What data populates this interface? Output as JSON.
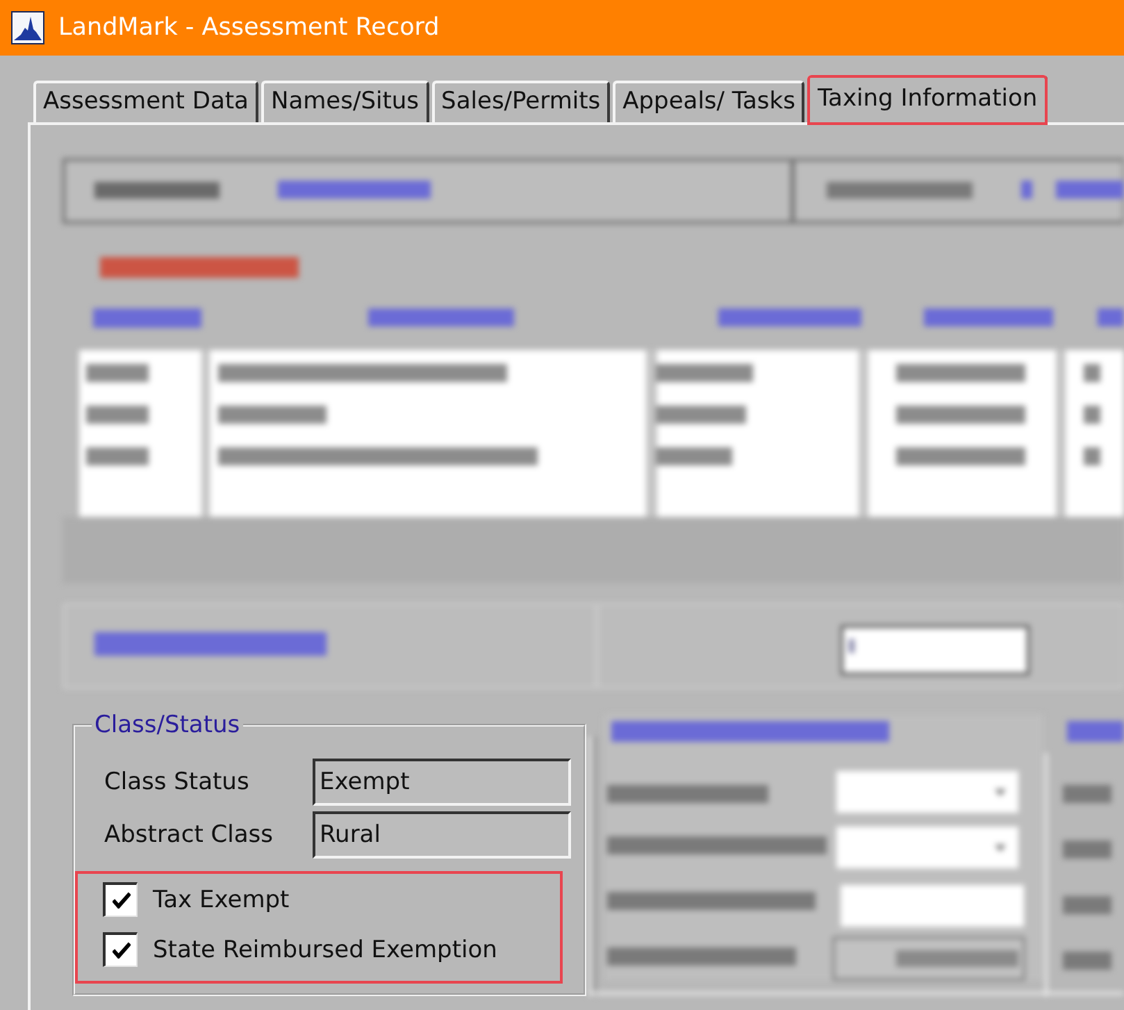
{
  "window": {
    "title": "LandMark - Assessment Record"
  },
  "tabs": [
    {
      "label": "Assessment Data",
      "selected": false,
      "highlighted": false
    },
    {
      "label": "Names/Situs",
      "selected": false,
      "highlighted": false
    },
    {
      "label": "Sales/Permits",
      "selected": false,
      "highlighted": false
    },
    {
      "label": "Appeals/ Tasks",
      "selected": false,
      "highlighted": false
    },
    {
      "label": "Taxing Information",
      "selected": true,
      "highlighted": true
    }
  ],
  "class_status": {
    "title": "Class/Status",
    "fields": [
      {
        "label": "Class Status",
        "value": "Exempt"
      },
      {
        "label": "Abstract Class",
        "value": "Rural"
      }
    ],
    "checkboxes_highlighted": true,
    "checkboxes": [
      {
        "label": "Tax Exempt",
        "checked": true
      },
      {
        "label": "State Reimbursed Exemption",
        "checked": true
      }
    ]
  }
}
